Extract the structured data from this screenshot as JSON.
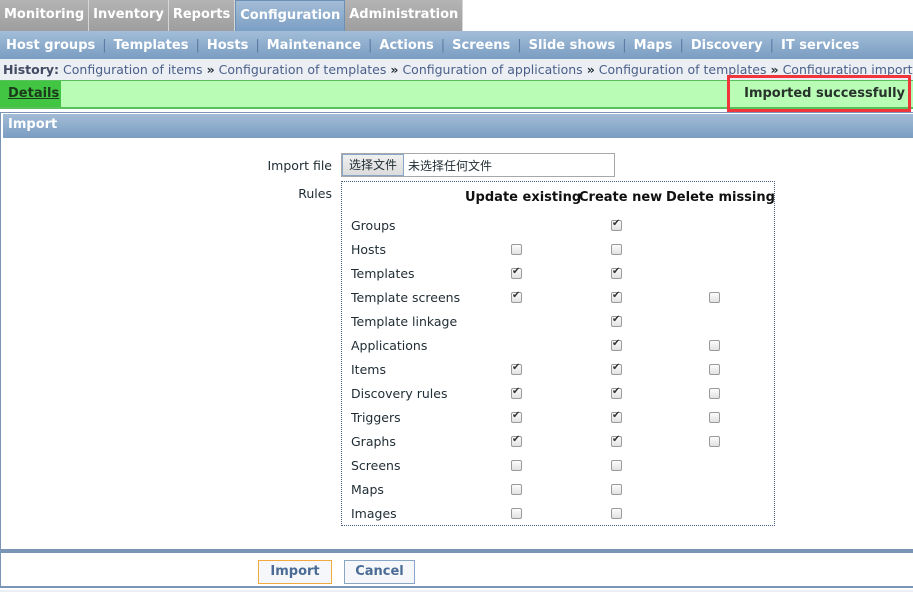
{
  "top_tabs": [
    {
      "label": "Monitoring",
      "active": false
    },
    {
      "label": "Inventory",
      "active": false
    },
    {
      "label": "Reports",
      "active": false
    },
    {
      "label": "Configuration",
      "active": true
    },
    {
      "label": "Administration",
      "active": false
    }
  ],
  "sub_nav": [
    "Host groups",
    "Templates",
    "Hosts",
    "Maintenance",
    "Actions",
    "Screens",
    "Slide shows",
    "Maps",
    "Discovery",
    "IT services"
  ],
  "history": {
    "label": "History:",
    "items": [
      "Configuration of items",
      "Configuration of templates",
      "Configuration of applications",
      "Configuration of templates",
      "Configuration import"
    ],
    "separator": "»"
  },
  "message": {
    "details_label": "Details",
    "text": "Imported successfully"
  },
  "form": {
    "title": "Import",
    "import_file_label": "Import file",
    "file_button_label": "选择文件",
    "file_status": "未选择任何文件",
    "rules_label": "Rules",
    "columns": [
      "Update existing",
      "Create new",
      "Delete missing"
    ],
    "rules": [
      {
        "name": "Groups",
        "update": null,
        "create": true,
        "delete": null
      },
      {
        "name": "Hosts",
        "update": false,
        "create": false,
        "delete": null
      },
      {
        "name": "Templates",
        "update": true,
        "create": true,
        "delete": null
      },
      {
        "name": "Template screens",
        "update": true,
        "create": true,
        "delete": false
      },
      {
        "name": "Template linkage",
        "update": null,
        "create": true,
        "delete": null
      },
      {
        "name": "Applications",
        "update": null,
        "create": true,
        "delete": false
      },
      {
        "name": "Items",
        "update": true,
        "create": true,
        "delete": false
      },
      {
        "name": "Discovery rules",
        "update": true,
        "create": true,
        "delete": false
      },
      {
        "name": "Triggers",
        "update": true,
        "create": true,
        "delete": false
      },
      {
        "name": "Graphs",
        "update": true,
        "create": true,
        "delete": false
      },
      {
        "name": "Screens",
        "update": false,
        "create": false,
        "delete": null
      },
      {
        "name": "Maps",
        "update": false,
        "create": false,
        "delete": null
      },
      {
        "name": "Images",
        "update": false,
        "create": false,
        "delete": null
      }
    ]
  },
  "footer": {
    "import_label": "Import",
    "cancel_label": "Cancel"
  }
}
